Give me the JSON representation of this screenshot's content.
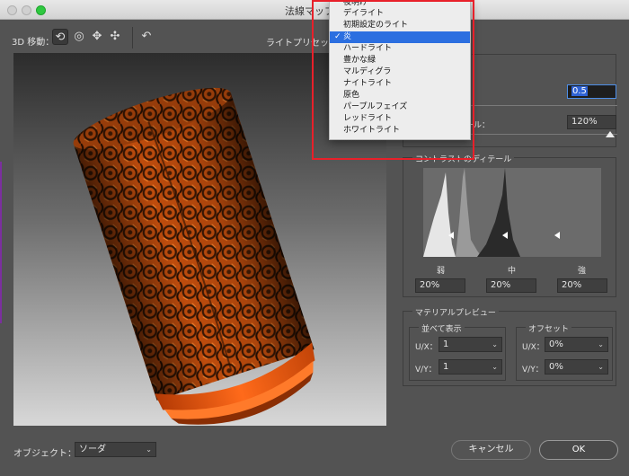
{
  "window": {
    "title": "法線マップを"
  },
  "toolbar": {
    "mode_label": "3D 移動：",
    "tools": [
      {
        "icon": "rotate-icon",
        "glyph": "⟲"
      },
      {
        "icon": "roll-icon",
        "glyph": "◎"
      },
      {
        "icon": "pan-icon",
        "glyph": "✥"
      },
      {
        "icon": "slide-icon",
        "glyph": "✣"
      },
      {
        "icon": "reset-view-icon",
        "glyph": "↶"
      }
    ],
    "light_preset_label": "ライトプリセット"
  },
  "light_menu": {
    "items": [
      "夜明け",
      "デイライト",
      "初期設定のライト",
      "炎",
      "ハードライト",
      "豊かな緑",
      "マルディグラ",
      "ナイトライト",
      "原色",
      "パープルフェイズ",
      "レッドライト",
      "ホワイトライト"
    ],
    "selected_index": 3,
    "check_glyph": "✓"
  },
  "detail": {
    "title_partial": "ール",
    "sub_partial": "さ",
    "height_value": "0.5",
    "scale_label_partial": "ケール：",
    "scale_value": "120%"
  },
  "contrast": {
    "title": "コントラストのディテール",
    "low_label": "弱",
    "mid_label": "中",
    "high_label": "強",
    "low_value": "20%",
    "mid_value": "20%",
    "high_value": "20%"
  },
  "material": {
    "title": "マテリアルプレビュー",
    "tile_title": "並べて表示",
    "offset_title": "オフセット",
    "ux_label": "U/X：",
    "vy_label": "V/Y：",
    "tile_ux": "1",
    "tile_vy": "1",
    "offset_ux": "0%",
    "offset_vy": "0%"
  },
  "footer": {
    "object_label": "オブジェクト：",
    "object_value": "ソーダ",
    "cancel_label": "キャンセル",
    "ok_label": "OK"
  },
  "colors": {
    "highlight_box": "#e8202a",
    "menu_selected": "#2c6fe0",
    "can_orange": "#e05a10"
  }
}
